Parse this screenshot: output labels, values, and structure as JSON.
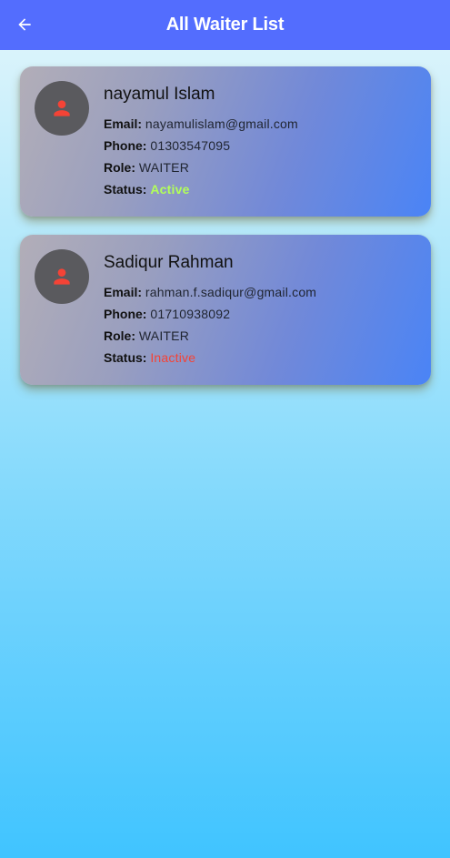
{
  "header": {
    "title": "All Waiter List",
    "back_icon": "arrow-back-icon",
    "background_color": "#536dfe"
  },
  "labels": {
    "email": "Email:",
    "phone": "Phone:",
    "role": "Role:",
    "status": "Status:"
  },
  "waiters": [
    {
      "name": "nayamul Islam",
      "email": "nayamulislam@gmail.com",
      "phone": "01303547095",
      "role": "WAITER",
      "status": "Active",
      "status_color": "#b2ff59",
      "avatar_icon": "person-icon"
    },
    {
      "name": "Sadiqur Rahman",
      "email": "rahman.f.sadiqur@gmail.com",
      "phone": "01710938092",
      "role": "WAITER",
      "status": "Inactive",
      "status_color": "#f44336",
      "avatar_icon": "person-icon"
    }
  ],
  "colors": {
    "avatar_icon": "#f44336",
    "avatar_bg": "#5a5a5e"
  }
}
